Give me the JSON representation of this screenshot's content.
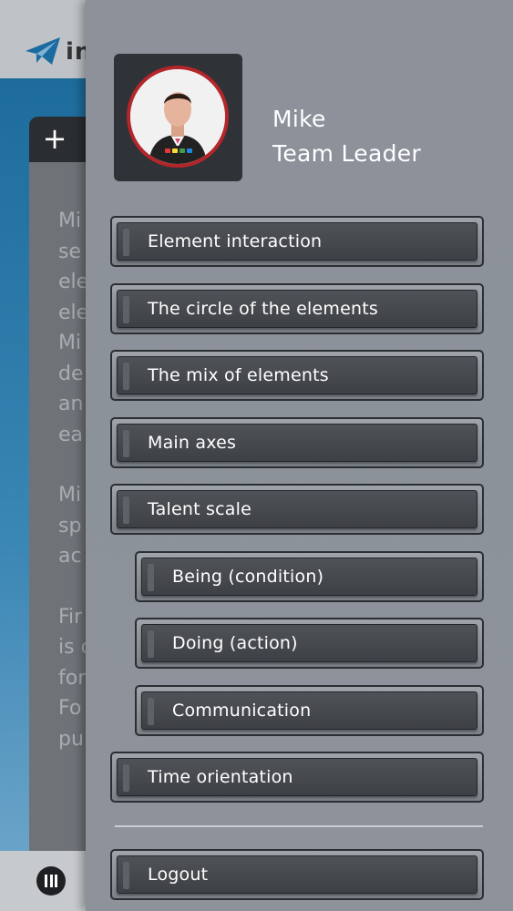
{
  "background": {
    "logo_text": "in",
    "card_lines": [
      "Mi",
      "se",
      "ele",
      "ele",
      "Mi",
      "de",
      "an",
      "ea",
      "",
      "Mi",
      "sp",
      "ac",
      "",
      "Fir",
      "is c",
      "for",
      "Fo",
      "pu"
    ],
    "add_symbol": "+"
  },
  "drawer": {
    "user": {
      "name": "Mike",
      "role": "Team Leader"
    },
    "menu": [
      {
        "label": "Element interaction"
      },
      {
        "label": "The circle of the elements"
      },
      {
        "label": "The mix of elements"
      },
      {
        "label": "Main axes"
      },
      {
        "label": "Talent scale"
      },
      {
        "label": "Being (condition)"
      },
      {
        "label": "Doing (action)"
      },
      {
        "label": "Communication"
      },
      {
        "label": "Time orientation"
      }
    ],
    "logout_label": "Logout"
  },
  "colors": {
    "drawer_bg": "#8c919a",
    "button_face": "#45484c",
    "avatar_ring": "#b3262a",
    "badge": [
      "#e53935",
      "#fdd835",
      "#43a047",
      "#1e88e5"
    ]
  }
}
